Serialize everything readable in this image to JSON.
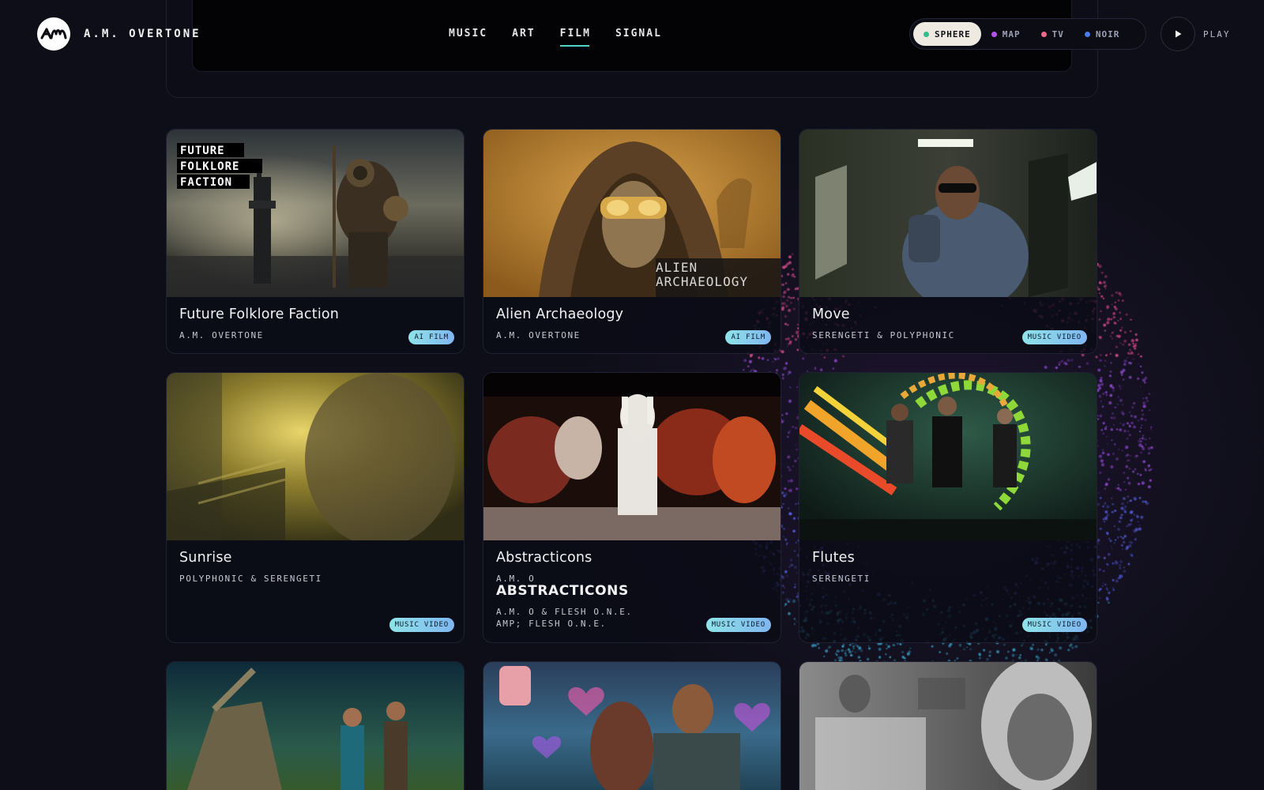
{
  "header": {
    "brand": "A.M. OVERTONE",
    "logo_text": "AM",
    "nav": [
      {
        "label": "MUSIC",
        "active": false
      },
      {
        "label": "ART",
        "active": false
      },
      {
        "label": "FILM",
        "active": true
      },
      {
        "label": "SIGNAL",
        "active": false
      }
    ],
    "modes": [
      {
        "label": "SPHERE",
        "color": "#2fbf8a",
        "active": true
      },
      {
        "label": "MAP",
        "color": "#b455e8",
        "active": false
      },
      {
        "label": "TV",
        "color": "#ef6a8e",
        "active": false
      },
      {
        "label": "NOIR",
        "color": "#4a7bea",
        "active": false
      }
    ],
    "play_label": "PLAY"
  },
  "cards": [
    {
      "title": "Future Folklore Faction",
      "artist": "A.M. OVERTONE",
      "badge": "AI FILM",
      "thumb_text": [
        "FUTURE",
        "FOLKLORE",
        "FACTION"
      ]
    },
    {
      "title": "Alien Archaeology",
      "artist": "A.M. OVERTONE",
      "badge": "AI FILM",
      "thumb_text": [
        "ALIEN",
        "ARCHAEOLOGY"
      ]
    },
    {
      "title": "Move",
      "artist": "SERENGETI & POLYPHONIC",
      "badge": "MUSIC VIDEO"
    },
    {
      "title": "Sunrise",
      "artist": "POLYPHONIC & SERENGETI",
      "badge": "MUSIC VIDEO"
    },
    {
      "title": "Abstracticons",
      "artist": "A.M. O",
      "subtitle": "ABSTRACTICONS",
      "artist_line2": "A.M. O & FLESH O.N.E.",
      "artist_line3": "AMP; FLESH O.N.E.",
      "badge": "MUSIC VIDEO"
    },
    {
      "title": "Flutes",
      "artist": "SERENGETI",
      "badge": "MUSIC VIDEO"
    },
    {
      "title": "",
      "artist": "",
      "badge": ""
    },
    {
      "title": "",
      "artist": "",
      "badge": ""
    },
    {
      "title": "",
      "artist": "",
      "badge": ""
    }
  ]
}
